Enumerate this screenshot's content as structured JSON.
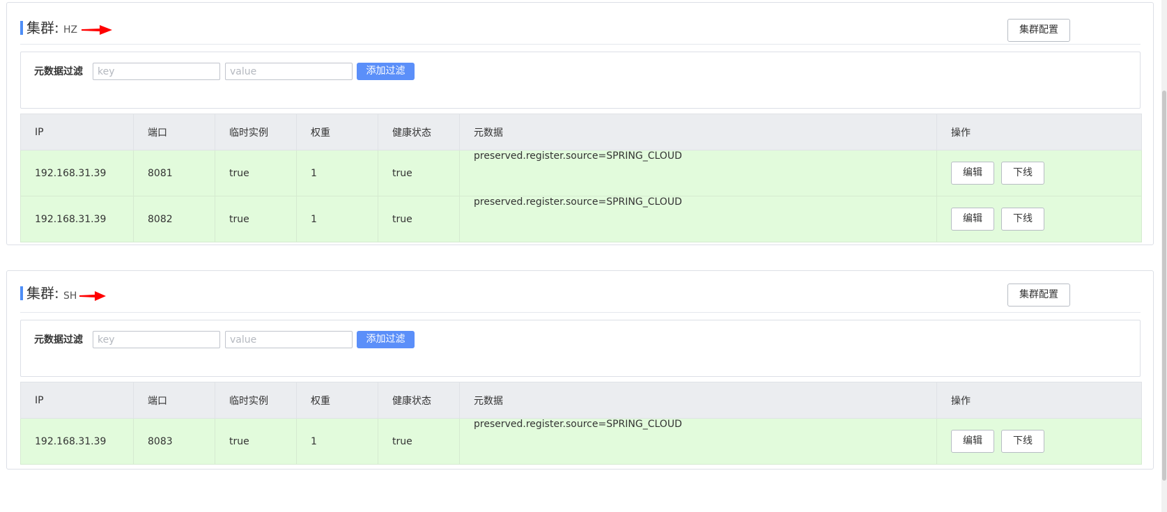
{
  "clusters": [
    {
      "title_label": "集群:",
      "name": "HZ",
      "config_button": "集群配置",
      "filter": {
        "label": "元数据过滤",
        "key_placeholder": "key",
        "value_placeholder": "value",
        "add_button": "添加过滤"
      },
      "columns": [
        "IP",
        "端口",
        "临时实例",
        "权重",
        "健康状态",
        "元数据",
        "操作"
      ],
      "rows": [
        {
          "ip": "192.168.31.39",
          "port": "8081",
          "ephemeral": "true",
          "weight": "1",
          "healthy": "true",
          "metadata": "preserved.register.source=SPRING_CLOUD",
          "edit": "编辑",
          "offline": "下线"
        },
        {
          "ip": "192.168.31.39",
          "port": "8082",
          "ephemeral": "true",
          "weight": "1",
          "healthy": "true",
          "metadata": "preserved.register.source=SPRING_CLOUD",
          "edit": "编辑",
          "offline": "下线"
        }
      ]
    },
    {
      "title_label": "集群:",
      "name": "SH",
      "config_button": "集群配置",
      "filter": {
        "label": "元数据过滤",
        "key_placeholder": "key",
        "value_placeholder": "value",
        "add_button": "添加过滤"
      },
      "columns": [
        "IP",
        "端口",
        "临时实例",
        "权重",
        "健康状态",
        "元数据",
        "操作"
      ],
      "rows": [
        {
          "ip": "192.168.31.39",
          "port": "8083",
          "ephemeral": "true",
          "weight": "1",
          "healthy": "true",
          "metadata": "preserved.register.source=SPRING_CLOUD",
          "edit": "编辑",
          "offline": "下线"
        }
      ]
    }
  ],
  "colors": {
    "accent": "#4e8ef7",
    "add_button": "#5b8ff9",
    "row_healthy": "#e2fbdc",
    "header_bg": "#ebedf0",
    "arrow": "#ff0000"
  },
  "icons": {
    "annotation": "red-arrow-icon"
  }
}
